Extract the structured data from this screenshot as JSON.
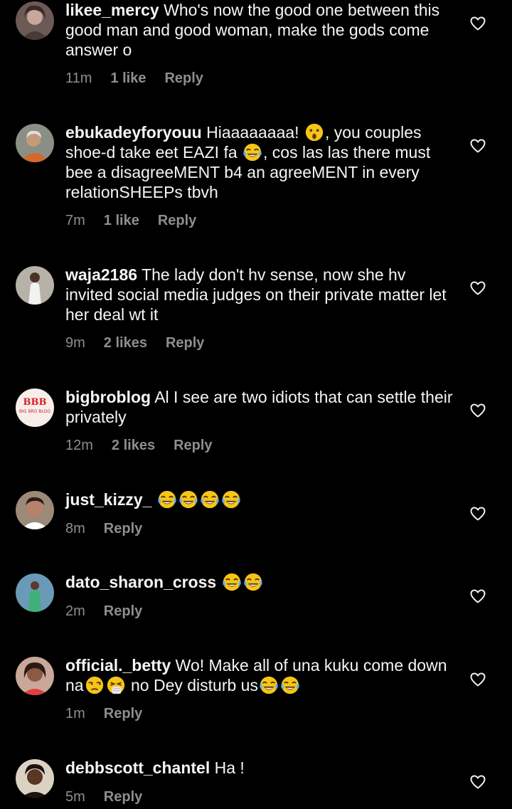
{
  "comments": [
    {
      "username": "likee_mercy",
      "text": "Who's now the good one between this good man and good woman, make the gods come answer o",
      "time": "11m",
      "likes": "1 like",
      "reply": "Reply"
    },
    {
      "username": "ebukadeyforyouu",
      "text_a": "Hiaaaaaaaa!",
      "text_b": ", you couples shoe-d take eet EAZI fa",
      "text_c": ", cos las las there must bee a disagreeMENT b4 an agreeMENT in every relationSHEEPs tbvh",
      "time": "7m",
      "likes": "1 like",
      "reply": "Reply"
    },
    {
      "username": "waja2186",
      "text": "The lady don't hv sense, now she hv invited social media judges on their private matter let her deal wt it",
      "time": "9m",
      "likes": "2 likes",
      "reply": "Reply"
    },
    {
      "username": "bigbroblog",
      "text": "Al I see are two idiots that can settle their privately",
      "time": "12m",
      "likes": "2 likes",
      "reply": "Reply",
      "avatar_text_top": "BBB",
      "avatar_text_bottom": "BIG BRO BLOG"
    },
    {
      "username": "just_kizzy_",
      "time": "8m",
      "reply": "Reply"
    },
    {
      "username": "dato_sharon_cross",
      "time": "2m",
      "reply": "Reply"
    },
    {
      "username": "official._betty",
      "text_a": "Wo! Make all of una kuku come down na",
      "text_b": "no Dey disturb us",
      "time": "1m",
      "reply": "Reply"
    },
    {
      "username": "debbscott_chantel",
      "text": "Ha !",
      "time": "5m",
      "reply": "Reply"
    }
  ],
  "icons": {
    "heart": "heart-outline-icon",
    "laugh": "face-with-tears-of-joy-emoji",
    "surprised": "hushed-face-emoji",
    "unamused": "unamused-face-emoji",
    "sneeze": "sneezing-face-emoji"
  },
  "colors": {
    "background": "#000000",
    "text": "#f5f5f5",
    "meta": "#8e8e8e"
  }
}
